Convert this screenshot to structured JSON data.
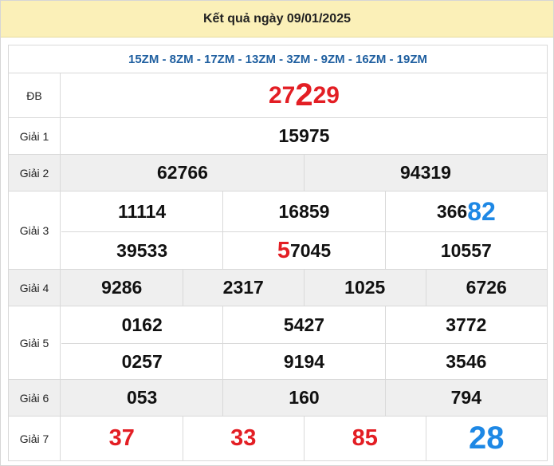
{
  "header": {
    "title": "Kết quả ngày 09/01/2025"
  },
  "codes": "15ZM - 8ZM - 17ZM - 13ZM - 3ZM - 9ZM - 16ZM - 19ZM",
  "db": {
    "label": "ĐB",
    "prefix": "27",
    "highlight": "2",
    "suffix": "29"
  },
  "g1": {
    "label": "Giải 1",
    "values": [
      "15975"
    ]
  },
  "g2": {
    "label": "Giải 2",
    "values": [
      "62766",
      "94319"
    ]
  },
  "g3": {
    "label": "Giải 3",
    "row1": [
      "11114",
      "16859"
    ],
    "row1_c3_prefix": "366",
    "row1_c3_highlight": "82",
    "row2_c1": "39533",
    "row2_c2_highlight": "5",
    "row2_c2_suffix": "7045",
    "row2_c3": "10557"
  },
  "g4": {
    "label": "Giải 4",
    "values": [
      "9286",
      "2317",
      "1025",
      "6726"
    ]
  },
  "g5": {
    "label": "Giải 5",
    "row1": [
      "0162",
      "5427",
      "3772"
    ],
    "row2": [
      "0257",
      "9194",
      "3546"
    ]
  },
  "g6": {
    "label": "Giải 6",
    "values": [
      "053",
      "160",
      "794"
    ]
  },
  "g7": {
    "label": "Giải 7",
    "values": [
      "37",
      "33",
      "85"
    ],
    "highlight": "28"
  },
  "colors": {
    "header_bg": "#fbf0b8",
    "red": "#e31e24",
    "blue": "#1e88e5",
    "code_blue": "#1f5fa0",
    "row_gray": "#efefef"
  }
}
